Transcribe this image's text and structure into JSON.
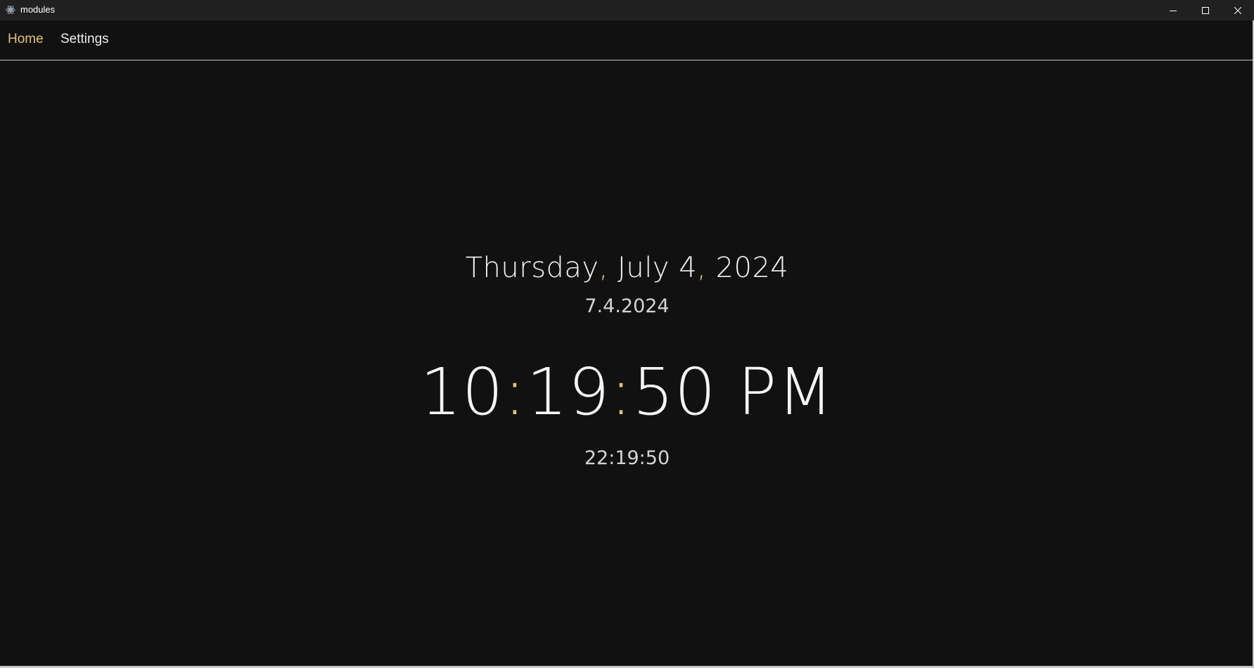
{
  "window": {
    "title": "modules",
    "controls": {
      "minimize_icon": "minimize-icon",
      "maximize_icon": "maximize-icon",
      "close_icon": "close-icon"
    }
  },
  "nav": {
    "items": [
      {
        "label": "Home",
        "active": true
      },
      {
        "label": "Settings",
        "active": false
      }
    ]
  },
  "clock": {
    "long_date": {
      "weekday": "Thursday",
      "sep1": ",",
      "month_day": " July 4",
      "sep2": ",",
      "year": " 2024"
    },
    "short_date": "7.4.2024",
    "time_12": {
      "hours": "10",
      "minutes": "19",
      "seconds": "50",
      "colon": ":",
      "ampm": " PM"
    },
    "time_24": "22:19:50"
  },
  "colors": {
    "background": "#111111",
    "titlebar": "#202020",
    "accent": "#e3c17b",
    "text": "#f2f2f2"
  }
}
